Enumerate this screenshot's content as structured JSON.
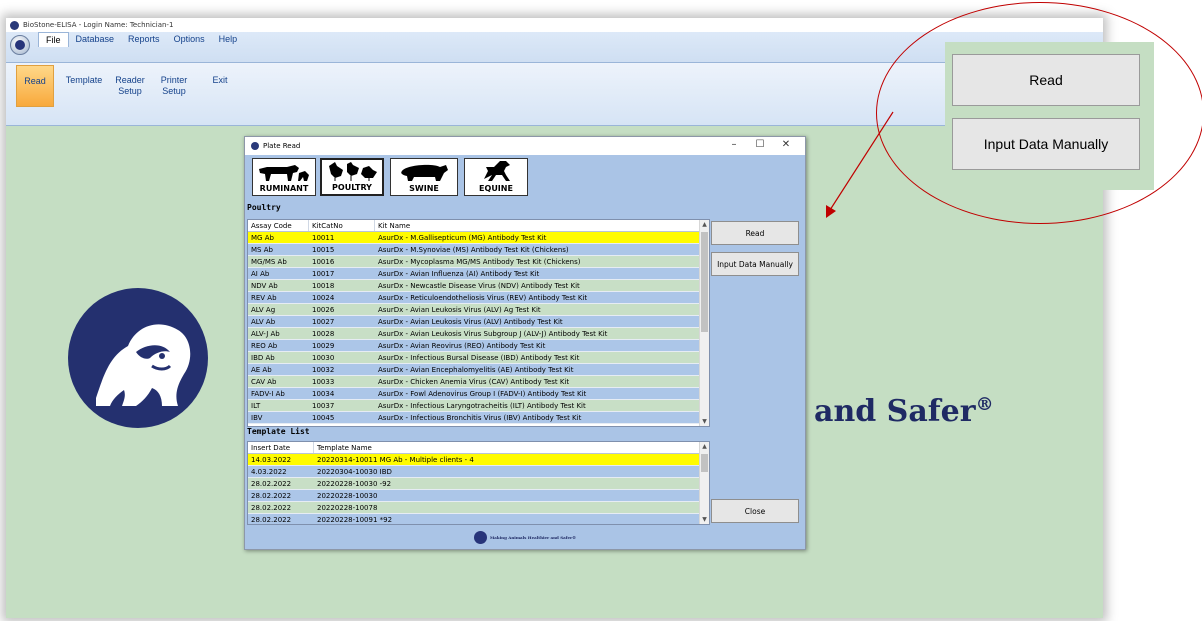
{
  "app": {
    "window_title": "BioStone-ELISA - Login Name: Technician-1",
    "menu_tabs": [
      "File",
      "Database",
      "Reports",
      "Options",
      "Help"
    ],
    "ribbon": {
      "read": "Read",
      "template": "Template",
      "reader_setup_1": "Reader",
      "reader_setup_2": "Setup",
      "printer_setup_1": "Printer",
      "printer_setup_2": "Setup",
      "exit": "Exit"
    },
    "slogan": "and Safer",
    "slogan_mark": "®"
  },
  "dialog": {
    "title": "Plate Read",
    "controls": {
      "minimize": "–",
      "maximize": "☐",
      "close": "✕"
    },
    "species": [
      "RUMINANT",
      "POULTRY",
      "SWINE",
      "EQUINE"
    ],
    "section_label": "Poultry",
    "kit_grid": {
      "headers": [
        "Assay Code",
        "KitCatNo",
        "Kit Name"
      ],
      "rows": [
        [
          "MG Ab",
          "10011",
          "AsurDx - M.Gallisepticum (MG) Antibody Test Kit"
        ],
        [
          "MS Ab",
          "10015",
          "AsurDx - M.Synoviae (MS) Antibody Test Kit (Chickens)"
        ],
        [
          "MG/MS Ab",
          "10016",
          "AsurDx - Mycoplasma MG/MS Antibody Test Kit (Chickens)"
        ],
        [
          "AI Ab",
          "10017",
          "AsurDx - Avian Influenza (AI) Antibody Test Kit"
        ],
        [
          "NDV Ab",
          "10018",
          "AsurDx - Newcastle Disease Virus (NDV) Antibody Test Kit"
        ],
        [
          "REV Ab",
          "10024",
          "AsurDx - Reticuloendotheliosis Virus (REV) Antibody Test Kit"
        ],
        [
          "ALV Ag",
          "10026",
          "AsurDx - Avian Leukosis Virus (ALV) Ag Test Kit"
        ],
        [
          "ALV Ab",
          "10027",
          "AsurDx - Avian Leukosis Virus (ALV) Antibody Test Kit"
        ],
        [
          "ALV-J Ab",
          "10028",
          "AsurDx - Avian Leukosis Virus Subgroup J (ALV-J) Antibody Test Kit"
        ],
        [
          "REO Ab",
          "10029",
          "AsurDx - Avian Reovirus (REO) Antibody Test Kit"
        ],
        [
          "IBD Ab",
          "10030",
          "AsurDx - Infectious Bursal Disease (IBD) Antibody Test Kit"
        ],
        [
          "AE Ab",
          "10032",
          "AsurDx - Avian Encephalomyelitis (AE) Antibody Test Kit"
        ],
        [
          "CAV Ab",
          "10033",
          "AsurDx - Chicken Anemia Virus (CAV) Antibody Test Kit"
        ],
        [
          "FADV-I Ab",
          "10034",
          "AsurDx - Fowl Adenovirus Group I (FADV-I) Antibody Test Kit"
        ],
        [
          "ILT",
          "10037",
          "AsurDx - Infectious Laryngotracheitis (ILT) Antibody Test Kit"
        ],
        [
          "IBV",
          "10045",
          "AsurDx - Infectious Bronchitis Virus (IBV) Antibody Test Kit"
        ]
      ]
    },
    "template_label": "Template List",
    "template_grid": {
      "headers": [
        "Insert Date",
        "Template Name"
      ],
      "rows": [
        [
          "14.03.2022",
          "20220314-10011 MG Ab  - Multiple clients - 4"
        ],
        [
          "4.03.2022",
          "20220304-10030 IBD"
        ],
        [
          "28.02.2022",
          "20220228-10030 -92"
        ],
        [
          "28.02.2022",
          "20220228-10030"
        ],
        [
          "28.02.2022",
          "20220228-10078"
        ],
        [
          "28.02.2022",
          "20220228-10091 *92"
        ]
      ]
    },
    "buttons": {
      "read": "Read",
      "input_manual": "Input Data Manually",
      "close": "Close"
    },
    "footer_text": "Making Animals Healthier and Safer®"
  },
  "callout": {
    "read": "Read",
    "input_manual": "Input Data Manually"
  },
  "colors": {
    "selected_row": "#fffb00",
    "row_green": "#c8dfc6",
    "row_blue": "#acc6e8",
    "callout_red": "#c00000",
    "brand_navy": "#1f2a64"
  }
}
